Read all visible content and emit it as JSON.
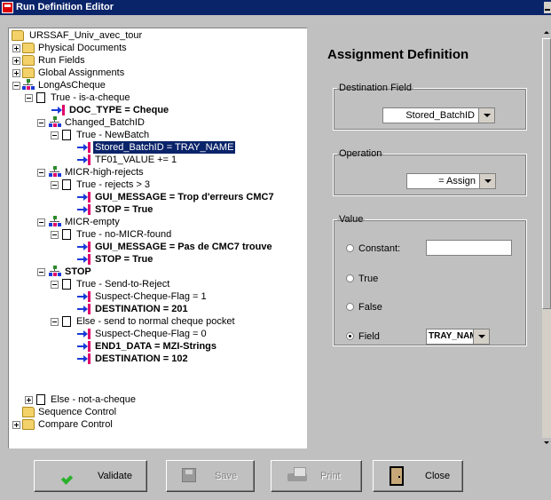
{
  "window": {
    "title": "Run Definition Editor"
  },
  "tree": [
    {
      "label": "URSSAF_Univ_avec_tour",
      "icon": "open-folder-icon",
      "expander": null,
      "bold": false,
      "selected": false
    },
    {
      "label": "Physical Documents",
      "icon": "folder-icon",
      "expander": "plus",
      "bold": false,
      "selected": false
    },
    {
      "label": "Run Fields",
      "icon": "folder-icon",
      "expander": "plus",
      "bold": false,
      "selected": false
    },
    {
      "label": "Global Assignments",
      "icon": "folder-icon",
      "expander": "plus",
      "bold": false,
      "selected": false
    },
    {
      "label": "LongAsCheque",
      "icon": "condition-tree-icon",
      "expander": "minus",
      "bold": false,
      "selected": false
    },
    {
      "label": "True - is-a-cheque",
      "icon": "document-icon",
      "expander": "minus",
      "bold": false,
      "selected": false
    },
    {
      "label": "DOC_TYPE = Cheque",
      "icon": "assignment-arrow-icon",
      "expander": null,
      "bold": true,
      "selected": false
    },
    {
      "label": "Changed_BatchID",
      "icon": "condition-tree-icon",
      "expander": "minus",
      "bold": false,
      "selected": false
    },
    {
      "label": "True - NewBatch",
      "icon": "document-icon",
      "expander": "minus",
      "bold": false,
      "selected": false
    },
    {
      "label": "Stored_BatchID = TRAY_NAME",
      "icon": "assignment-arrow-icon",
      "expander": null,
      "bold": false,
      "selected": true
    },
    {
      "label": "TF01_VALUE += 1",
      "icon": "assignment-arrow-icon",
      "expander": null,
      "bold": false,
      "selected": false
    },
    {
      "label": "MICR-high-rejects",
      "icon": "condition-tree-icon",
      "expander": "minus",
      "bold": false,
      "selected": false
    },
    {
      "label": "True - rejects > 3",
      "icon": "document-icon",
      "expander": "minus",
      "bold": false,
      "selected": false
    },
    {
      "label": "GUI_MESSAGE = Trop d'erreurs CMC7",
      "icon": "assignment-arrow-icon",
      "expander": null,
      "bold": true,
      "selected": false
    },
    {
      "label": "STOP = True",
      "icon": "assignment-arrow-icon",
      "expander": null,
      "bold": true,
      "selected": false
    },
    {
      "label": "MICR-empty",
      "icon": "condition-tree-icon",
      "expander": "minus",
      "bold": false,
      "selected": false
    },
    {
      "label": "True - no-MICR-found",
      "icon": "document-icon",
      "expander": "minus",
      "bold": false,
      "selected": false
    },
    {
      "label": "GUI_MESSAGE = Pas de CMC7 trouve",
      "icon": "assignment-arrow-icon",
      "expander": null,
      "bold": true,
      "selected": false
    },
    {
      "label": "STOP = True",
      "icon": "assignment-arrow-icon",
      "expander": null,
      "bold": true,
      "selected": false
    },
    {
      "label": "STOP",
      "icon": "condition-tree-icon",
      "expander": "minus",
      "bold": true,
      "selected": false
    },
    {
      "label": "True - Send-to-Reject",
      "icon": "document-icon",
      "expander": "minus",
      "bold": false,
      "selected": false
    },
    {
      "label": "Suspect-Cheque-Flag = 1",
      "icon": "assignment-arrow-icon",
      "expander": null,
      "bold": false,
      "selected": false
    },
    {
      "label": "DESTINATION = 201",
      "icon": "assignment-arrow-icon",
      "expander": null,
      "bold": true,
      "selected": false
    },
    {
      "label": "Else - send to normal cheque pocket",
      "icon": "document-icon",
      "expander": "minus",
      "bold": false,
      "selected": false
    },
    {
      "label": "Suspect-Cheque-Flag = 0",
      "icon": "assignment-arrow-icon",
      "expander": null,
      "bold": false,
      "selected": false
    },
    {
      "label": "END1_DATA = MZI-Strings",
      "icon": "assignment-arrow-icon",
      "expander": null,
      "bold": true,
      "selected": false
    },
    {
      "label": "DESTINATION = 102",
      "icon": "assignment-arrow-icon",
      "expander": null,
      "bold": true,
      "selected": false
    },
    {
      "label": "Else - not-a-cheque",
      "icon": "document-icon",
      "expander": "plus",
      "bold": false,
      "selected": false
    },
    {
      "label": "Sequence Control",
      "icon": "folder-icon",
      "expander": null,
      "bold": false,
      "selected": false
    },
    {
      "label": "Compare Control",
      "icon": "folder-icon",
      "expander": "plus",
      "bold": false,
      "selected": false
    }
  ],
  "panel": {
    "title": "Assignment Definition",
    "destination": {
      "legend": "Destination Field",
      "value": "Stored_BatchID"
    },
    "operation": {
      "legend": "Operation",
      "value": "= Assign"
    },
    "value": {
      "legend": "Value",
      "constant_label": "Constant:",
      "constant_value": "",
      "true_label": "True",
      "false_label": "False",
      "field_label": "Field",
      "field_value": "TRAY_NAME",
      "selected": "Field"
    }
  },
  "buttons": {
    "validate": "Validate",
    "save": "Save",
    "print": "Print",
    "close": "Close"
  },
  "colors": {
    "title_bar": "#0a246a",
    "selection": "#0a246a",
    "validate_check": "#2bb02b",
    "arrow_blue": "#1a3ad8",
    "arrow_bar": "#e0006a"
  }
}
